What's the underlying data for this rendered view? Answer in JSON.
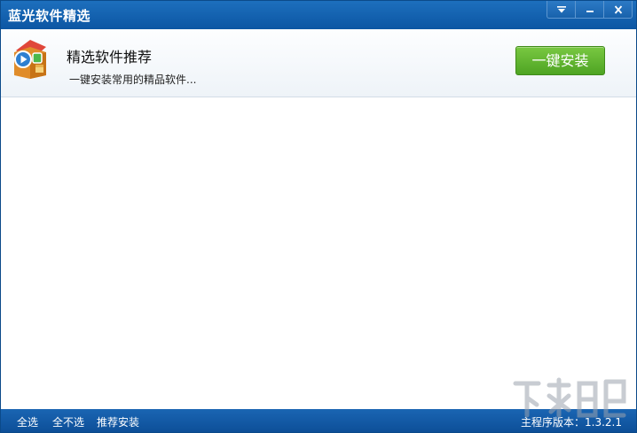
{
  "window": {
    "title": "蓝光软件精选"
  },
  "header": {
    "title": "精选软件推荐",
    "subtitle": "一键安装常用的精品软件...",
    "install_button": "一键安装"
  },
  "footer": {
    "select_all": "全选",
    "select_none": "全不选",
    "recommend_install": "推荐安装",
    "version_label": "主程序版本：1.3.2.1"
  },
  "colors": {
    "titlebar": "#0c56a3",
    "install_button": "#5aae2c",
    "footer": "#0d4f98"
  },
  "icons": [
    "menu-dropdown-icon",
    "minimize-icon",
    "close-icon",
    "app-logo-icon",
    "site-watermark-logo"
  ]
}
